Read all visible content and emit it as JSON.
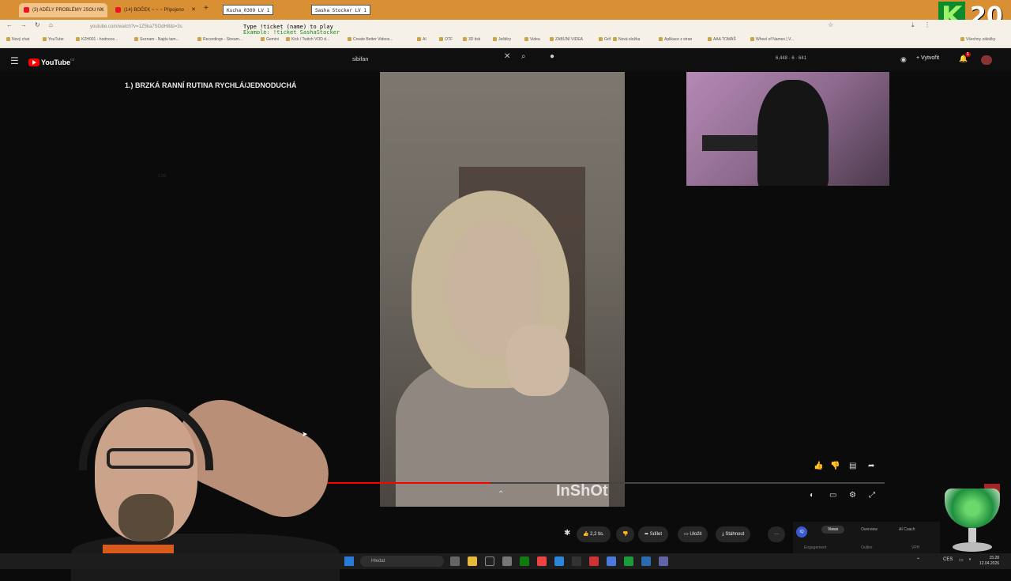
{
  "browser": {
    "tabs": [
      {
        "label": "(3) ADÉLY PROBLÉMY JSOU N...",
        "active": true
      },
      {
        "label": "(14) BOČEK ~ ~ ~ Připojeno",
        "active": false
      }
    ],
    "overlay_chips": [
      "Kucha_0309 LV 1",
      "Sasha Stocker LV 1"
    ],
    "address": "youtube.com/watch?v=1Z5ka7SOdH8&t=3s",
    "overlay_line1": "Type !ticket (name) to play",
    "overlay_line2": "Example: !ticket SashaStocker",
    "bookmarks": [
      "Nový chat",
      "YouTube",
      "KZH001 - hodnoce...",
      "Seznam - Najdu tam...",
      "Recordings - Stream...",
      "Gemini",
      "Kick / Twitch VOD d...",
      "Create Better Videos...",
      "AI",
      "OTF",
      "3D tisk",
      "Ještěry",
      "Videa",
      "ZABÍJNÍ VIDEA",
      "Grif",
      "Nová složka",
      "Aplikace z stran",
      "AAA TOMÁŠ",
      "Wheel of Names | V...",
      "Všechny záložky"
    ]
  },
  "stream_badge": {
    "letter": "K",
    "number": "20"
  },
  "youtube": {
    "logo_text": "YouTube",
    "logo_region": "CZ",
    "search_value": "sibifan",
    "stats": "6,448 · 6 · 641",
    "create_label": "Vytvořit",
    "notification_count": "1",
    "video_title": "1.) BRZKÁ RANNÍ RUTINA RYCHLÁ/JEDNODUCHÁ",
    "video_watermark": "InShOt",
    "faint_time": "1:20",
    "progress": 0.42,
    "actions": {
      "likes": "2,2 tis.",
      "share": "Sdílet",
      "save": "Uložit",
      "download": "Stáhnout",
      "more": "···"
    },
    "side_panel": {
      "icon_label": "IQ",
      "tabs": [
        "Views",
        "Overview",
        "AI Coach"
      ],
      "row": [
        "Engagement",
        "Outlier",
        "VPH"
      ]
    }
  },
  "taskbar": {
    "search_placeholder": "Hledat",
    "lang": "CES",
    "time": "15:28",
    "date": "12.04.2026"
  },
  "colors": {
    "tab_bar": "#d98f33",
    "youtube_red": "#ff0000",
    "badge_green": "#0d8a2a"
  }
}
